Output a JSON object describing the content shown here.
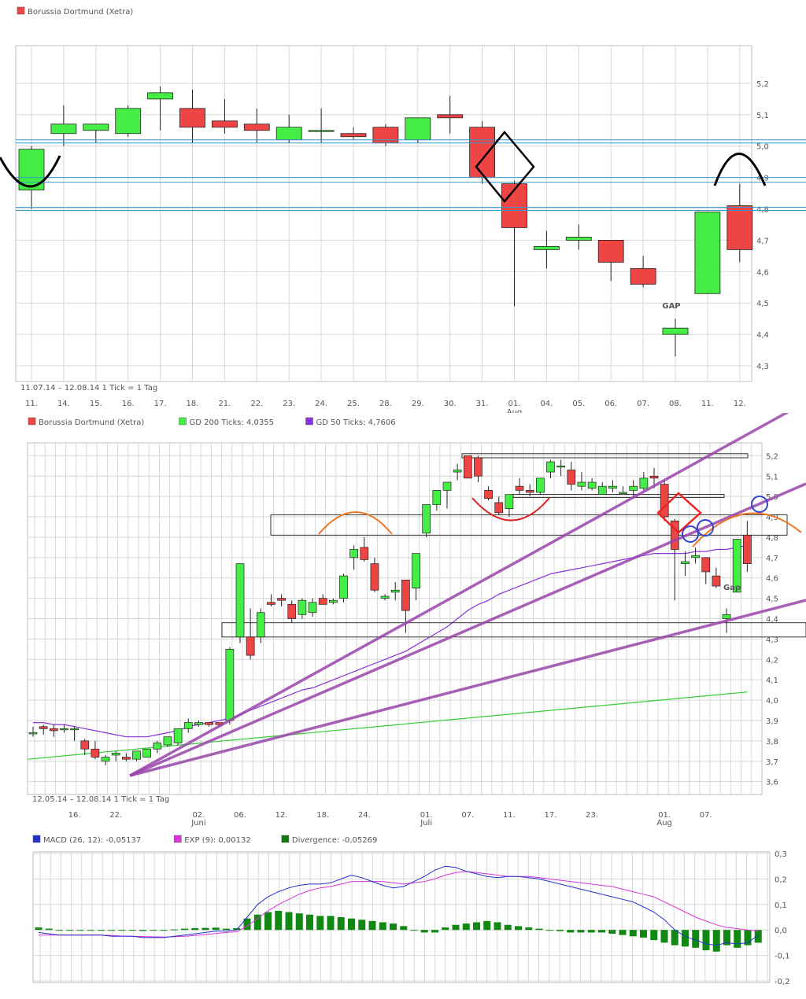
{
  "colors": {
    "up": "#44ee44",
    "down": "#ee4444",
    "grid": "#d7d7d7",
    "frame": "#bdbdbd"
  },
  "chart_data": [
    {
      "type": "candlestick",
      "legend": [
        {
          "name": "Borussia Dortmund (Xetra)",
          "color": "#ee4444"
        }
      ],
      "range_label": "11.07.14 – 12.08.14   1 Tick = 1 Tag",
      "month_labels": [
        {
          "label": "Aug",
          "index": 15
        }
      ],
      "ylim": [
        4.27,
        5.3
      ],
      "yticks": [
        "5,2",
        "5,1",
        "5,0",
        "4,9",
        "4,8",
        "4,7",
        "4,6",
        "4,5",
        "4,4",
        "4,3"
      ],
      "x": [
        "11.",
        "14.",
        "15.",
        "16.",
        "17.",
        "18.",
        "21.",
        "22.",
        "23.",
        "24.",
        "25.",
        "28.",
        "29.",
        "30.",
        "31.",
        "01.",
        "04.",
        "05.",
        "06.",
        "07.",
        "08.",
        "11.",
        "12."
      ],
      "ohlc": [
        [
          4.86,
          5.0,
          4.8,
          4.99
        ],
        [
          5.04,
          5.13,
          5.0,
          5.07
        ],
        [
          5.05,
          5.07,
          5.01,
          5.07
        ],
        [
          5.04,
          5.13,
          5.03,
          5.12
        ],
        [
          5.15,
          5.19,
          5.05,
          5.17
        ],
        [
          5.12,
          5.18,
          5.01,
          5.06
        ],
        [
          5.08,
          5.15,
          5.04,
          5.06
        ],
        [
          5.07,
          5.12,
          5.01,
          5.05
        ],
        [
          5.02,
          5.1,
          5.01,
          5.06
        ],
        [
          5.05,
          5.12,
          5.01,
          5.05
        ],
        [
          5.04,
          5.06,
          5.02,
          5.03
        ],
        [
          5.06,
          5.07,
          5.0,
          5.01
        ],
        [
          5.02,
          5.09,
          5.01,
          5.09
        ],
        [
          5.1,
          5.16,
          5.04,
          5.09
        ],
        [
          5.06,
          5.08,
          4.88,
          4.9
        ],
        [
          4.88,
          4.89,
          4.49,
          4.74
        ],
        [
          4.67,
          4.73,
          4.61,
          4.68
        ],
        [
          4.7,
          4.75,
          4.67,
          4.71
        ],
        [
          4.7,
          4.7,
          4.57,
          4.63
        ],
        [
          4.61,
          4.65,
          4.55,
          4.56
        ],
        [
          4.4,
          4.45,
          4.33,
          4.42
        ],
        [
          4.53,
          4.79,
          4.53,
          4.79
        ],
        [
          4.81,
          4.88,
          4.63,
          4.67
        ]
      ],
      "annotation": "GAP"
    },
    {
      "type": "candlestick",
      "legend": [
        {
          "name": "Borussia Dortmund (Xetra)",
          "color": "#ee4444"
        },
        {
          "name": "GD 200 Ticks: 4,0355",
          "color": "#44ee44"
        },
        {
          "name": "GD 50 Ticks: 4,7606",
          "color": "#8833dd"
        }
      ],
      "range_label": "12.05.14 – 12.08.14   1 Tick = 1 Tag",
      "month_labels": [
        {
          "label": "Juni",
          "index": 16
        },
        {
          "label": "Juli",
          "index": 38
        },
        {
          "label": "Aug",
          "index": 61
        }
      ],
      "ylim": [
        3.56,
        5.24
      ],
      "yticks": [
        "5,2",
        "5,1",
        "5,0",
        "4,9",
        "4,8",
        "4,7",
        "4,6",
        "4,5",
        "4,4",
        "4,3",
        "4,2",
        "4,1",
        "4,0",
        "3,9",
        "3,8",
        "3,7",
        "3,6"
      ],
      "x_ticks": [
        {
          "label": "16.",
          "index": 4
        },
        {
          "label": "22.",
          "index": 8
        },
        {
          "label": "02.",
          "index": 16
        },
        {
          "label": "06.",
          "index": 20
        },
        {
          "label": "12.",
          "index": 24
        },
        {
          "label": "18.",
          "index": 28
        },
        {
          "label": "24.",
          "index": 32
        },
        {
          "label": "01.",
          "index": 38
        },
        {
          "label": "07.",
          "index": 42
        },
        {
          "label": "11.",
          "index": 46
        },
        {
          "label": "17.",
          "index": 50
        },
        {
          "label": "23.",
          "index": 54
        },
        {
          "label": "01.",
          "index": 61
        },
        {
          "label": "07.",
          "index": 65
        }
      ],
      "ohlc": [
        [
          3.84,
          3.87,
          3.82,
          3.84
        ],
        [
          3.87,
          3.88,
          3.83,
          3.86
        ],
        [
          3.86,
          3.88,
          3.82,
          3.85
        ],
        [
          3.86,
          3.88,
          3.84,
          3.86
        ],
        [
          3.86,
          3.87,
          3.8,
          3.86
        ],
        [
          3.8,
          3.81,
          3.73,
          3.76
        ],
        [
          3.76,
          3.8,
          3.71,
          3.72
        ],
        [
          3.7,
          3.73,
          3.68,
          3.72
        ],
        [
          3.73,
          3.75,
          3.7,
          3.74
        ],
        [
          3.72,
          3.74,
          3.7,
          3.71
        ],
        [
          3.71,
          3.75,
          3.7,
          3.75
        ],
        [
          3.72,
          3.76,
          3.72,
          3.76
        ],
        [
          3.76,
          3.8,
          3.74,
          3.79
        ],
        [
          3.78,
          3.82,
          3.77,
          3.82
        ],
        [
          3.79,
          3.86,
          3.78,
          3.86
        ],
        [
          3.86,
          3.91,
          3.84,
          3.89
        ],
        [
          3.88,
          3.9,
          3.87,
          3.89
        ],
        [
          3.89,
          3.89,
          3.87,
          3.88
        ],
        [
          3.89,
          3.89,
          3.87,
          3.88
        ],
        [
          3.9,
          4.26,
          3.88,
          4.25
        ],
        [
          4.31,
          4.67,
          4.28,
          4.67
        ],
        [
          4.31,
          4.45,
          4.2,
          4.22
        ],
        [
          4.31,
          4.45,
          4.28,
          4.43
        ],
        [
          4.48,
          4.52,
          4.46,
          4.47
        ],
        [
          4.5,
          4.52,
          4.46,
          4.49
        ],
        [
          4.47,
          4.49,
          4.38,
          4.4
        ],
        [
          4.42,
          4.5,
          4.4,
          4.49
        ],
        [
          4.43,
          4.5,
          4.41,
          4.48
        ],
        [
          4.5,
          4.52,
          4.47,
          4.47
        ],
        [
          4.48,
          4.5,
          4.47,
          4.49
        ],
        [
          4.5,
          4.62,
          4.48,
          4.61
        ],
        [
          4.7,
          4.76,
          4.64,
          4.74
        ],
        [
          4.75,
          4.8,
          4.68,
          4.69
        ],
        [
          4.67,
          4.7,
          4.53,
          4.54
        ],
        [
          4.5,
          4.52,
          4.49,
          4.51
        ],
        [
          4.53,
          4.58,
          4.49,
          4.54
        ],
        [
          4.59,
          4.59,
          4.33,
          4.44
        ],
        [
          4.55,
          4.72,
          4.49,
          4.72
        ],
        [
          4.82,
          4.9,
          4.8,
          4.96
        ],
        [
          4.96,
          5.03,
          4.93,
          5.03
        ],
        [
          5.03,
          5.07,
          4.94,
          5.07
        ],
        [
          5.12,
          5.16,
          5.08,
          5.13
        ],
        [
          5.2,
          5.2,
          5.1,
          5.09
        ],
        [
          5.19,
          5.2,
          5.07,
          5.1
        ],
        [
          5.03,
          5.05,
          4.98,
          4.99
        ],
        [
          4.97,
          5.0,
          4.91,
          4.92
        ],
        [
          4.94,
          5.0,
          4.9,
          5.01
        ],
        [
          5.05,
          5.09,
          5.01,
          5.03
        ],
        [
          5.03,
          5.06,
          5.0,
          5.02
        ],
        [
          5.02,
          5.09,
          5.01,
          5.09
        ],
        [
          5.12,
          5.18,
          5.09,
          5.17
        ],
        [
          5.15,
          5.18,
          5.1,
          5.15
        ],
        [
          5.13,
          5.17,
          5.03,
          5.06
        ],
        [
          5.05,
          5.12,
          5.03,
          5.07
        ],
        [
          5.04,
          5.09,
          5.03,
          5.07
        ],
        [
          5.01,
          5.07,
          5.01,
          5.05
        ],
        [
          5.04,
          5.08,
          5.02,
          5.05
        ],
        [
          5.02,
          5.05,
          5.02,
          5.02
        ],
        [
          5.03,
          5.08,
          5.0,
          5.05
        ],
        [
          5.04,
          5.12,
          5.03,
          5.09
        ],
        [
          5.1,
          5.14,
          5.04,
          5.09
        ],
        [
          5.06,
          5.08,
          4.88,
          4.9
        ],
        [
          4.88,
          4.89,
          4.49,
          4.74
        ],
        [
          4.67,
          4.73,
          4.61,
          4.68
        ],
        [
          4.7,
          4.75,
          4.67,
          4.71
        ],
        [
          4.7,
          4.7,
          4.57,
          4.63
        ],
        [
          4.61,
          4.65,
          4.55,
          4.56
        ],
        [
          4.4,
          4.45,
          4.33,
          4.42
        ],
        [
          4.53,
          4.79,
          4.53,
          4.79
        ],
        [
          4.81,
          4.88,
          4.63,
          4.67
        ]
      ],
      "gd200": {
        "start": 3.71,
        "end": 4.04
      },
      "gd50": [
        3.89,
        3.89,
        3.88,
        3.88,
        3.87,
        3.86,
        3.85,
        3.84,
        3.83,
        3.82,
        3.82,
        3.82,
        3.83,
        3.84,
        3.85,
        3.87,
        3.88,
        3.89,
        3.9,
        3.91,
        3.93,
        3.95,
        3.97,
        3.99,
        4.01,
        4.03,
        4.05,
        4.06,
        4.08,
        4.1,
        4.12,
        4.14,
        4.16,
        4.18,
        4.2,
        4.22,
        4.24,
        4.27,
        4.3,
        4.33,
        4.36,
        4.4,
        4.44,
        4.47,
        4.49,
        4.52,
        4.54,
        4.56,
        4.58,
        4.6,
        4.62,
        4.63,
        4.64,
        4.65,
        4.66,
        4.67,
        4.68,
        4.69,
        4.7,
        4.71,
        4.72,
        4.72,
        4.72,
        4.72,
        4.73,
        4.73,
        4.74,
        4.74,
        4.75,
        4.76
      ],
      "annotation": "Gap"
    },
    {
      "type": "bar+line",
      "legend": [
        {
          "name": "MACD (26, 12): -0,05137",
          "color": "#2233cc"
        },
        {
          "name": "EXP (9): 0,00132",
          "color": "#dd33dd"
        },
        {
          "name": "Divergence: -0,05269",
          "color": "#117711"
        }
      ],
      "ylim": [
        -0.2,
        0.3
      ],
      "yticks": [
        "0,3",
        "0,2",
        "0,1",
        "0,0",
        "-0,1",
        "-0,2"
      ],
      "macd": [
        -0.01,
        -0.015,
        -0.02,
        -0.02,
        -0.02,
        -0.02,
        -0.02,
        -0.025,
        -0.025,
        -0.025,
        -0.03,
        -0.03,
        -0.03,
        -0.025,
        -0.02,
        -0.015,
        -0.01,
        -0.005,
        -0.005,
        0.0,
        0.05,
        0.1,
        0.13,
        0.15,
        0.165,
        0.175,
        0.18,
        0.18,
        0.185,
        0.2,
        0.215,
        0.205,
        0.19,
        0.175,
        0.165,
        0.17,
        0.19,
        0.21,
        0.235,
        0.25,
        0.245,
        0.23,
        0.22,
        0.21,
        0.205,
        0.21,
        0.21,
        0.205,
        0.2,
        0.19,
        0.18,
        0.17,
        0.16,
        0.15,
        0.14,
        0.13,
        0.12,
        0.11,
        0.09,
        0.07,
        0.04,
        0.0,
        -0.025,
        -0.04,
        -0.055,
        -0.06,
        -0.05,
        -0.055,
        -0.05,
        -0.02
      ],
      "exp": [
        -0.02,
        -0.02,
        -0.02,
        -0.02,
        -0.02,
        -0.02,
        -0.02,
        -0.022,
        -0.024,
        -0.025,
        -0.026,
        -0.027,
        -0.028,
        -0.027,
        -0.025,
        -0.022,
        -0.018,
        -0.014,
        -0.01,
        -0.007,
        0.015,
        0.045,
        0.075,
        0.1,
        0.12,
        0.14,
        0.155,
        0.165,
        0.17,
        0.18,
        0.19,
        0.19,
        0.19,
        0.19,
        0.185,
        0.18,
        0.185,
        0.19,
        0.2,
        0.215,
        0.225,
        0.23,
        0.225,
        0.22,
        0.215,
        0.21,
        0.21,
        0.21,
        0.205,
        0.2,
        0.195,
        0.19,
        0.185,
        0.18,
        0.175,
        0.17,
        0.16,
        0.15,
        0.14,
        0.13,
        0.11,
        0.09,
        0.07,
        0.05,
        0.035,
        0.02,
        0.01,
        0.005,
        0.0,
        -0.005
      ],
      "div": [
        0.01,
        0.005,
        0.0,
        0.0,
        0.0,
        0.0,
        0.0,
        -0.003,
        -0.001,
        0.0,
        -0.004,
        -0.003,
        -0.002,
        0.002,
        0.005,
        0.007,
        0.008,
        0.009,
        0.005,
        0.007,
        0.045,
        0.06,
        0.07,
        0.075,
        0.07,
        0.065,
        0.06,
        0.055,
        0.055,
        0.05,
        0.045,
        0.04,
        0.035,
        0.03,
        0.025,
        0.015,
        0.0,
        -0.01,
        -0.01,
        0.01,
        0.02,
        0.025,
        0.03,
        0.035,
        0.03,
        0.02,
        0.015,
        0.01,
        0.005,
        0.0,
        -0.005,
        -0.01,
        -0.01,
        -0.01,
        -0.01,
        -0.015,
        -0.02,
        -0.025,
        -0.03,
        -0.04,
        -0.05,
        -0.06,
        -0.065,
        -0.07,
        -0.08,
        -0.085,
        -0.06,
        -0.07,
        -0.06,
        -0.05
      ]
    }
  ]
}
